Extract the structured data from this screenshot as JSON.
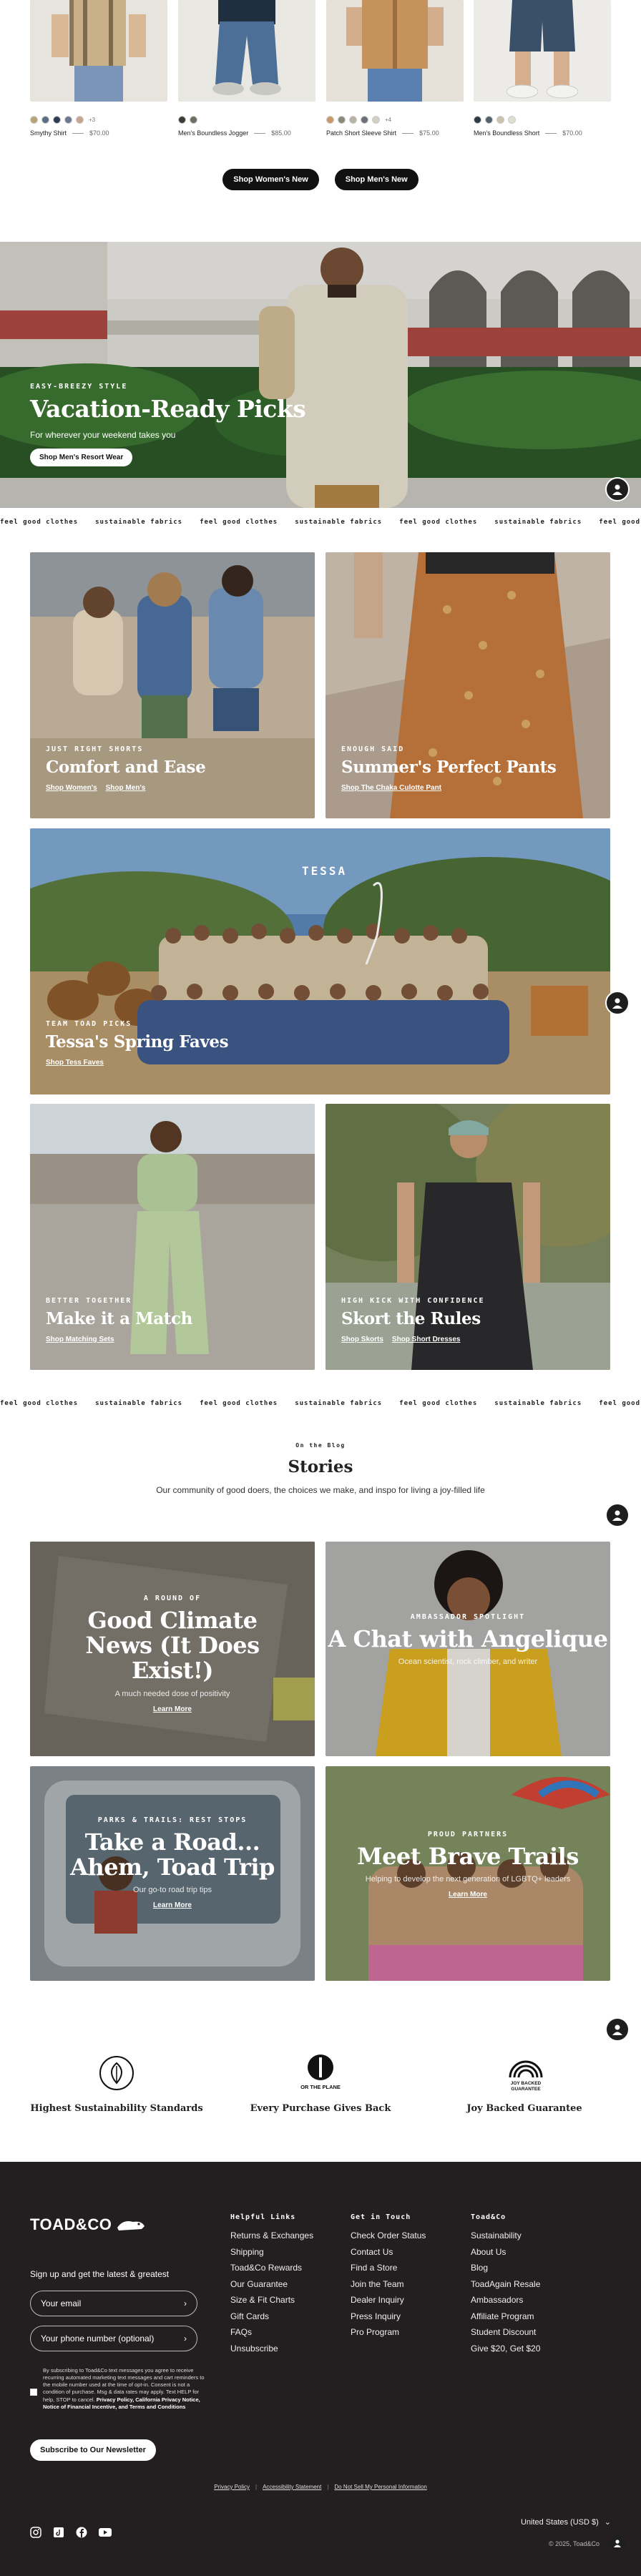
{
  "products": [
    {
      "name": "Smythy Shirt",
      "price": "$70.00",
      "more": "+3",
      "swatches": [
        "#b9a47a",
        "#5b6e86",
        "#2f3b55",
        "#6a7a8e",
        "#c7a48a"
      ]
    },
    {
      "name": "Men's Boundless Jogger",
      "price": "$85.00",
      "more": "",
      "swatches": [
        "#3c3a33",
        "#6b7060"
      ]
    },
    {
      "name": "Patch Short Sleeve Shirt",
      "price": "$75.00",
      "more": "+4",
      "swatches": [
        "#c99a63",
        "#8a8a7a",
        "#b8b2a4",
        "#6b6f7a",
        "#d4cfc2"
      ]
    },
    {
      "name": "Men's Boundless Short",
      "price": "$70.00",
      "more": "",
      "swatches": [
        "#2a3b44",
        "#52646b",
        "#c9c3ad",
        "#e1ddd1"
      ]
    }
  ],
  "shop_buttons": {
    "women": "Shop Women's New",
    "men": "Shop Men's New"
  },
  "hero": {
    "eyebrow": "Easy-Breezy Style",
    "title": "Vacation-Ready Picks",
    "subtitle": "For wherever your weekend takes you",
    "button": "Shop Men's Resort Wear"
  },
  "marquee": [
    "feel good clothes",
    "sustainable fabrics"
  ],
  "tiles": {
    "shorts": {
      "eyebrow": "Just Right Shorts",
      "title": "Comfort and Ease",
      "links": [
        "Shop Women's",
        "Shop Men's"
      ]
    },
    "pants": {
      "eyebrow": "Enough Said",
      "title": "Summer's Perfect Pants",
      "links": [
        "Shop The Chaka Culotte Pant"
      ]
    },
    "team": {
      "eyebrow": "Team Toad Picks",
      "title": "Tessa's Spring Faves",
      "links": [
        "Shop Tess Faves"
      ],
      "annotation": "TESSA"
    },
    "match": {
      "eyebrow": "Better Together",
      "title": "Make it a Match",
      "links": [
        "Shop Matching Sets"
      ]
    },
    "skort": {
      "eyebrow": "High Kick With Confidence",
      "title": "Skort the Rules",
      "links": [
        "Shop Skorts",
        "Shop Short Dresses"
      ]
    }
  },
  "stories": {
    "eyebrow": "On the Blog",
    "title": "Stories",
    "subtitle": "Our community of good doers, the choices we make, and inspo for living a joy-filled life",
    "items": [
      {
        "eyebrow": "A Round of",
        "title": "Good Climate News (It Does Exist!)",
        "sub": "A much needed dose of positivity",
        "more": "Learn More"
      },
      {
        "eyebrow": "Ambassador Spotlight",
        "title": "A Chat with Angelique",
        "sub": "Ocean scientist, rock climber, and writer",
        "more": ""
      },
      {
        "eyebrow": "Parks & Trails: Rest Stops",
        "title": "Take a Road... Ahem, Toad Trip",
        "sub": "Our go-to road trip tips",
        "more": "Learn More"
      },
      {
        "eyebrow": "Proud Partners",
        "title": "Meet Brave Trails",
        "sub": "Helping to develop the next generation of LGBTQ+ leaders",
        "more": "Learn More"
      }
    ]
  },
  "badges": [
    {
      "label": "Highest Sustainability Standards",
      "icon": "leaf-icon"
    },
    {
      "label": "Every Purchase Gives Back",
      "icon": "for-the-planet-icon",
      "icon_text": "FOR THE PLANET"
    },
    {
      "label": "Joy Backed Guarantee",
      "icon": "rainbow-icon",
      "icon_text": "JOY BACKED GUARANTEE"
    }
  ],
  "footer": {
    "logo": "TOAD&CO",
    "signup_label": "Sign up and get the latest & greatest",
    "email_placeholder": "Your email",
    "phone_placeholder": "Your phone number (optional)",
    "consent_text": "By subscribing to Toad&Co text messages you agree to receive recurring automated marketing text messages and cart reminders to the mobile number used at the time of opt-in. Consent is not a condition of purchase. Msg & data rates may apply. Text HELP for help, STOP to cancel.",
    "consent_links": "Privacy Policy, California Privacy Notice, Notice of Financial Incentive, and Terms and Conditions",
    "newsletter_button": "Subscribe to Our Newsletter",
    "columns": [
      {
        "heading": "Helpful Links",
        "items": [
          "Returns & Exchanges",
          "Shipping",
          "Toad&Co Rewards",
          "Our Guarantee",
          "Size & Fit Charts",
          "Gift Cards",
          "FAQs",
          "Unsubscribe"
        ]
      },
      {
        "heading": "Get in Touch",
        "items": [
          "Check Order Status",
          "Contact Us",
          "Find a Store",
          "Join the Team",
          "Dealer Inquiry",
          "Press Inquiry",
          "Pro Program"
        ]
      },
      {
        "heading": "Toad&Co",
        "items": [
          "Sustainability",
          "About Us",
          "Blog",
          "ToadAgain Resale",
          "Ambassadors",
          "Affiliate Program",
          "Student Discount",
          "Give $20, Get $20"
        ]
      }
    ],
    "legal": [
      "Privacy Policy",
      "Accessibility Statement",
      "Do Not Sell My Personal Information"
    ],
    "region": "United States (USD $)",
    "copyright": "© 2025, Toad&Co"
  },
  "colors": {
    "dark": "#231f20",
    "accent": "#111111"
  }
}
